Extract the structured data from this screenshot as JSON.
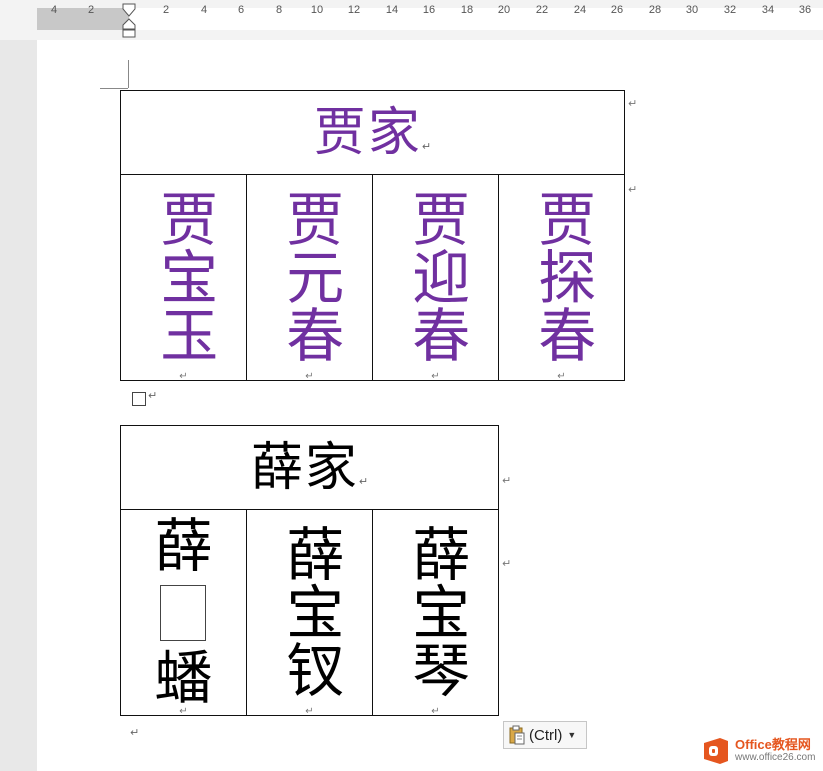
{
  "ruler": {
    "left_ticks": [
      "4",
      "2"
    ],
    "right_ticks": [
      "2",
      "4",
      "6",
      "8",
      "10",
      "12",
      "14",
      "16",
      "18",
      "20",
      "22",
      "24",
      "26",
      "28",
      "30",
      "32",
      "34",
      "36"
    ]
  },
  "table1": {
    "header": "贾家",
    "columns": [
      "贾宝玉",
      "贾元春",
      "贾迎春",
      "贾探春"
    ],
    "text_color": "#7030a0"
  },
  "table2": {
    "header": "薛家",
    "col1_top": "薛",
    "col1_bottom": "蟠",
    "col2": "薛宝钗",
    "col3": "薛宝琴",
    "text_color": "#000000"
  },
  "marks": {
    "paragraph": "↵",
    "cell": "↵"
  },
  "paste_options": {
    "label": "(Ctrl)"
  },
  "watermark": {
    "title": "Office教程网",
    "url": "www.office26.com"
  }
}
